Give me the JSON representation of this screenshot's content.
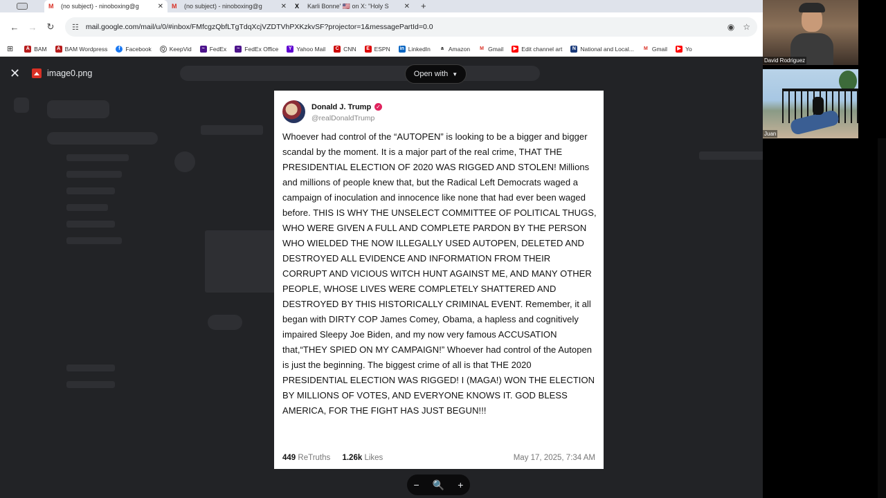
{
  "browser": {
    "tabs": [
      {
        "title": "(no subject) - ninoboxing@g",
        "favicon": "gmail-icon",
        "active": true
      },
      {
        "title": "(no subject) - ninoboxing@g",
        "favicon": "gmail-icon",
        "active": false
      },
      {
        "title": "Karli Bonne' 🇺🇸 on X: \"Holy S",
        "favicon": "x-icon",
        "active": false
      }
    ],
    "new_tab": "+",
    "url": "mail.google.com/mail/u/0/#inbox/FMfcgzQbfLTgTdqXcjVZDTVhPXKzkvSF?projector=1&messagePartId=0.0",
    "bookmarks": [
      "BAM",
      "BAM Wordpress",
      "Facebook",
      "KeepVid",
      "FedEx",
      "FedEx Office",
      "Yahoo Mail",
      "CNN",
      "ESPN",
      "LinkedIn",
      "Amazon",
      "Gmail",
      "Edit channel art",
      "National and Local...",
      "Gmail",
      "Yo"
    ]
  },
  "viewer": {
    "file_name": "image0.png",
    "open_with_label": "Open with",
    "zoom_out": "−",
    "zoom_icon": "magnifier-icon",
    "zoom_in": "+"
  },
  "post": {
    "author": "Donald J. Trump",
    "handle": "@realDonaldTrump",
    "text": "Whoever had control of the “AUTOPEN” is looking to be a bigger and bigger scandal by the moment. It is a major part of the real crime, THAT THE PRESIDENTIAL ELECTION OF 2020 WAS RIGGED AND STOLEN! Millions and millions of people knew that, but the Radical Left Democrats waged a campaign of inoculation and innocence like none that had ever been waged before. THIS IS WHY THE UNSELECT COMMITTEE OF POLITICAL THUGS, WHO WERE GIVEN A FULL AND COMPLETE PARDON BY THE PERSON WHO WIELDED THE NOW ILLEGALLY USED AUTOPEN, DELETED AND DESTROYED ALL EVIDENCE AND INFORMATION FROM THEIR CORRUPT AND VICIOUS WITCH HUNT AGAINST ME, AND MANY OTHER PEOPLE, WHOSE LIVES WERE COMPLETELY SHATTERED AND DESTROYED BY THIS HISTORICALLY CRIMINAL EVENT. Remember, it all began with DIRTY COP James Comey, Obama, a hapless and cognitively impaired Sleepy Joe Biden, and my now very famous ACCUSATION that,“THEY SPIED ON MY CAMPAIGN!” Whoever had control of the  Autopen is just the beginning. The biggest crime of all is that THE 2020 PRESIDENTIAL ELECTION WAS RIGGED! I (MAGA!) WON THE ELECTION BY MILLIONS OF VOTES, AND EVERYONE KNOWS IT. GOD BLESS AMERICA, FOR THE FIGHT HAS JUST BEGUN!!!",
    "retruths_count": "449",
    "retruths_label": "ReTruths",
    "likes_count": "1.26k",
    "likes_label": "Likes",
    "date": "May 17, 2025, 7:34 AM"
  },
  "meeting": {
    "participants": [
      "David Rodriguez",
      "Juan"
    ]
  }
}
